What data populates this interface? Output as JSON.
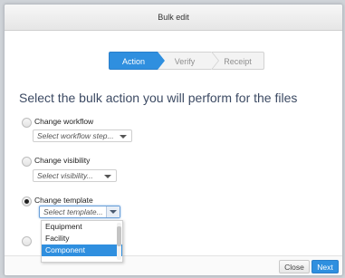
{
  "dialog": {
    "title": "Bulk edit"
  },
  "wizard": {
    "steps": [
      {
        "label": "Action",
        "active": true
      },
      {
        "label": "Verify",
        "active": false
      },
      {
        "label": "Receipt",
        "active": false
      }
    ]
  },
  "heading": "Select the bulk action you will perform for the files",
  "options": {
    "workflow": {
      "label": "Change workflow",
      "checked": false,
      "placeholder": "Select workflow step..."
    },
    "visibility": {
      "label": "Change visibility",
      "checked": false,
      "placeholder": "Select visibility..."
    },
    "template": {
      "label": "Change template",
      "checked": true,
      "placeholder": "Select template..."
    },
    "fourth": {
      "checked": false
    }
  },
  "template_dropdown": {
    "items": [
      "Equipment",
      "Facility",
      "Component"
    ],
    "highlighted": "Component"
  },
  "footer": {
    "close_label": "Close",
    "next_label": "Next"
  },
  "colors": {
    "accent": "#2f8fdf",
    "heading": "#3c4a63"
  }
}
